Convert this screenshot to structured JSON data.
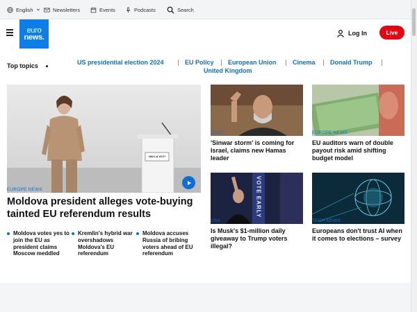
{
  "utility": {
    "language": "English",
    "newsletters": "Newsletters",
    "events": "Events",
    "podcasts": "Podcasts",
    "search": "Search"
  },
  "header": {
    "logo_line1": "euro",
    "logo_line2": "news.",
    "login": "Log In",
    "live": "Live"
  },
  "top_topics": {
    "label": "Top topics",
    "items": [
      "US presidential election 2024",
      "EU Policy",
      "European Union",
      "Cinema",
      "Donald Trump",
      "United Kingdom"
    ]
  },
  "main_story": {
    "category": "EUROPE NEWS",
    "title": "Moldova president alleges vote-buying tainted EU referendum results",
    "podium_sign": "HAI LA VOT!",
    "related": [
      "Moldova votes yes to join the EU as president claims Moscow meddled",
      "Kremlin's hybrid war overshadows Moldova's EU referendum",
      "Moldova accuses Russia of bribing voters ahead of EU referendum"
    ]
  },
  "cards": [
    {
      "category": "GAZA",
      "title": "'Sinwar storm' is coming for Israel, claims new Hamas leader"
    },
    {
      "category": "EUROPE NEWS",
      "title": "EU auditors warn of double payout risk amid shifting budget model"
    },
    {
      "category": "USA",
      "title": "Is Musk's $1-million daily giveaway to Trump voters illegal?",
      "banner": "VOTE EARLY"
    },
    {
      "category": "TECH NEWS",
      "title": "Europeans don't trust AI when it comes to elections – survey"
    }
  ],
  "colors": {
    "brand_blue": "#0d7ee8",
    "link_blue": "#0d6fd1",
    "live_red": "#e30613"
  }
}
